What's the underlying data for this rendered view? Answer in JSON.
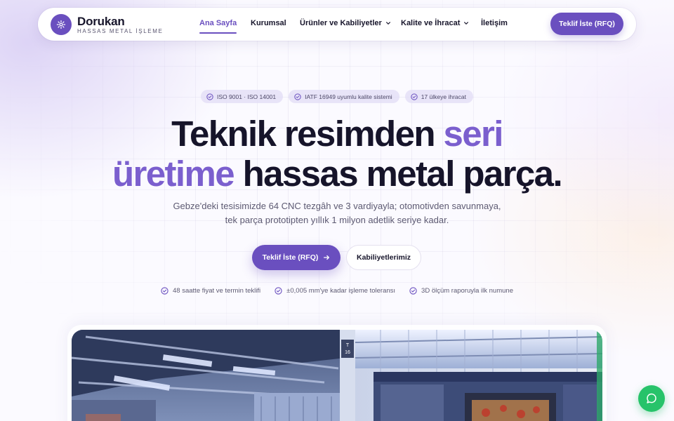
{
  "brand": {
    "name": "Dorukan",
    "tagline": "HASSAS METAL İŞLEME"
  },
  "nav": {
    "items": [
      {
        "label": "Ana Sayfa",
        "active": true
      },
      {
        "label": "Kurumsal",
        "active": false
      },
      {
        "label": "Ürünler ve Kabiliyetler",
        "active": false,
        "dropdown": true
      },
      {
        "label": "Kalite ve İhracat",
        "active": false,
        "dropdown": true
      },
      {
        "label": "İletişim",
        "active": false
      }
    ],
    "cta_label": "Teklif İste (RFQ)"
  },
  "badges": [
    {
      "label": "ISO 9001 · ISO 14001",
      "icon": "check-circle-icon"
    },
    {
      "label": "IATF 16949 uyumlu kalite sistemi",
      "icon": "check-circle-icon"
    },
    {
      "label": "17 ülkeye ihracat",
      "icon": "check-circle-icon"
    }
  ],
  "hero": {
    "line1_plain": "Teknik resimden",
    "line1_accent": "seri",
    "line2_accent": "üretime",
    "line2_plain": "hassas metal parça",
    "line2_end": ".",
    "subtitle": "Gebze'deki tesisimizde 64 CNC tezgâh ve 3 vardiyayla; otomotivden savunmaya, tek parça prototipten yıllık 1 milyon adetlik seriye kadar.",
    "cta_primary": "Teklif İste (RFQ)",
    "cta_secondary": "Kabiliyetlerimiz"
  },
  "features": [
    {
      "label": "48 saatte fiyat ve termin teklifi"
    },
    {
      "label": "±0,005 mm'ye kadar işleme toleransı"
    },
    {
      "label": "3D ölçüm raporuyla ilk numune"
    }
  ],
  "hero_image": {
    "sign_text": "T\n16"
  },
  "colors": {
    "accent": "#6a4fbf",
    "accent_light": "#7b5fce",
    "text": "#16142a",
    "muted": "#5d5a72",
    "chat": "#27c36a"
  }
}
